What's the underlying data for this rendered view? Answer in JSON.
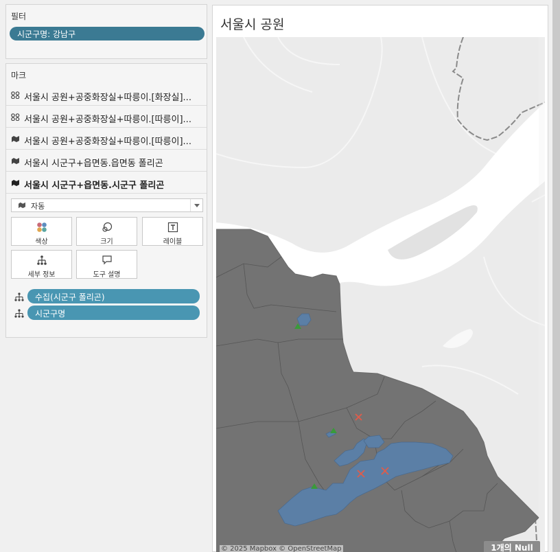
{
  "filter_panel": {
    "title": "필터",
    "pill": "시군구명: 강남구"
  },
  "marks_panel": {
    "title": "마크",
    "layers": [
      {
        "label": "서울시 공원+공중화장실+따릉이.[화장실]...",
        "icon": "multi-circle-icon"
      },
      {
        "label": "서울시 공원+공중화장실+따릉이.[따릉이]...",
        "icon": "multi-circle-icon"
      },
      {
        "label": "서울시 공원+공중화장실+따릉이.[따릉이]...",
        "icon": "map-layer-icon"
      },
      {
        "label": "서울시 시군구+읍면동.읍면동 폴리곤",
        "icon": "map-layer-icon"
      },
      {
        "label": "서울시 시군구+읍면동.시군구 폴리곤",
        "icon": "map-layer-icon"
      }
    ],
    "mark_type": "자동",
    "cards": {
      "color": "색상",
      "size": "크기",
      "label": "레이블",
      "detail": "세부 정보",
      "tooltip": "도구 설명"
    },
    "fields": [
      "수집(시군구 폴리곤)",
      "시군구명"
    ]
  },
  "map": {
    "title": "서울시 공원",
    "attribution": "© 2025 Mapbox © OpenStreetMap",
    "null_badge": "1개의 Null",
    "colors": {
      "district_fill": "#737373",
      "park_fill": "#5b7fa6",
      "toilet_marker": "#e05c4a",
      "bike_marker": "#3a9a3a",
      "river": "#ffffff",
      "land": "#ebebeb"
    }
  }
}
